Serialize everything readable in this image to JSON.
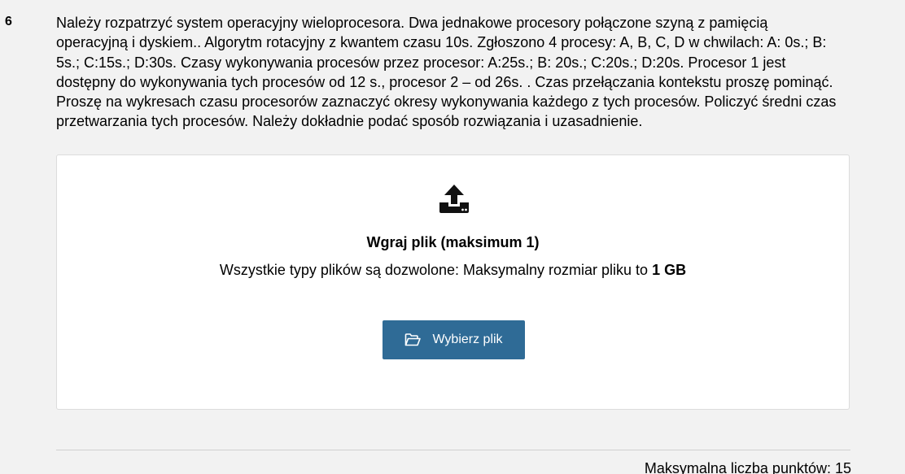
{
  "question": {
    "number": "6",
    "text": "Należy rozpatrzyć system operacyjny wieloprocesora. Dwa jednakowe procesory połączone szyną z pamięcią operacyjną i dyskiem.. Algorytm rotacyjny z kwantem czasu 10s. Zgłoszono 4 procesy: A, B, C, D w chwilach: A: 0s.; B: 5s.; C:15s.; D:30s. Czasy wykonywania procesów przez procesor: A:25s.; B: 20s.; C:20s.; D:20s. Procesor 1 jest dostępny do wykonywania tych procesów od 12 s., procesor 2 – od 26s. . Czas przełączania kontekstu proszę pominąć. Proszę na wykresach czasu procesorów zaznaczyć okresy wykonywania każdego z tych procesów. Policzyć średni czas przetwarzania tych procesów. Należy dokładnie podać sposób rozwiązania i uzasadnienie."
  },
  "upload": {
    "icon": "upload-icon",
    "title": "Wgraj plik (maksimum 1)",
    "info_prefix": "Wszystkie typy plików są dozwolone: Maksymalny rozmiar pliku to ",
    "max_size": "1 GB",
    "button_icon": "folder-open-icon",
    "button_label": "Wybierz plik",
    "button_color": "#2f6b96"
  },
  "footer": {
    "max_points": "Maksymalna liczba punktów: 15"
  }
}
